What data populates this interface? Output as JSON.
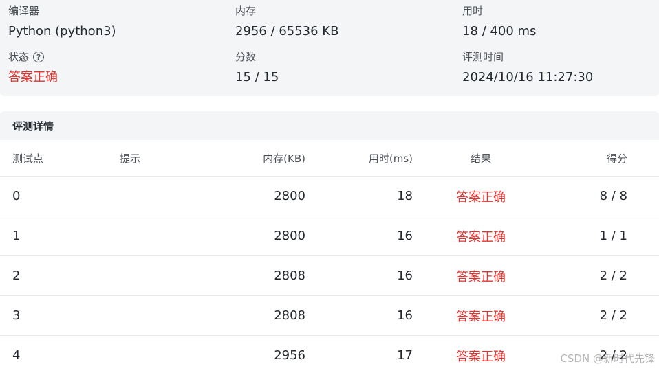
{
  "summary": {
    "compiler_label": "编译器",
    "compiler_value": "Python (python3)",
    "memory_label": "内存",
    "memory_value": "2956 / 65536 KB",
    "time_label": "用时",
    "time_value": "18 / 400 ms",
    "status_label": "状态",
    "status_help": "?",
    "status_value": "答案正确",
    "score_label": "分数",
    "score_value": "15 / 15",
    "judge_time_label": "评测时间",
    "judge_time_value": "2024/10/16 11:27:30"
  },
  "details": {
    "title": "评测详情",
    "columns": {
      "case": "测试点",
      "hint": "提示",
      "memory": "内存(KB)",
      "time": "用时(ms)",
      "result": "结果",
      "score": "得分"
    },
    "rows": [
      {
        "case": "0",
        "hint": "",
        "memory": "2800",
        "time": "18",
        "result": "答案正确",
        "score": "8 / 8"
      },
      {
        "case": "1",
        "hint": "",
        "memory": "2800",
        "time": "16",
        "result": "答案正确",
        "score": "1 / 1"
      },
      {
        "case": "2",
        "hint": "",
        "memory": "2808",
        "time": "16",
        "result": "答案正确",
        "score": "2 / 2"
      },
      {
        "case": "3",
        "hint": "",
        "memory": "2808",
        "time": "16",
        "result": "答案正确",
        "score": "2 / 2"
      },
      {
        "case": "4",
        "hint": "",
        "memory": "2956",
        "time": "17",
        "result": "答案正确",
        "score": "2 / 2"
      }
    ]
  },
  "watermark": "CSDN @新时代先锋",
  "colors": {
    "accepted": "#e3342f",
    "panel_bg": "#f4f5f7"
  }
}
